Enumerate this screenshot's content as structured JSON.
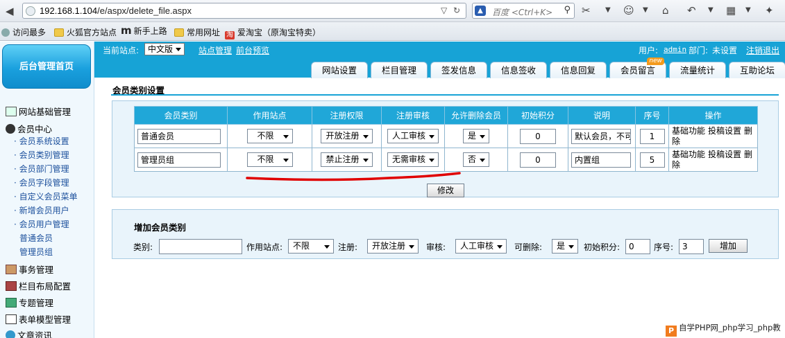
{
  "browser": {
    "url_host": "192.168.1.104",
    "url_path": "/e/aspx/delete_file.aspx",
    "search_placeholder": "百度 <Ctrl+K>",
    "bookmarks": [
      "访问最多",
      "火狐官方站点",
      "新手上路",
      "常用网址",
      "爱淘宝（原淘宝特卖）"
    ],
    "bookmark_m_logo": "m",
    "taobao_glyph": "淘"
  },
  "sidebar": {
    "home_label": "后台管理首页",
    "items": [
      {
        "label": "网站基础管理"
      },
      {
        "label": "会员中心"
      }
    ],
    "member_subitems": [
      "会员系统设置",
      "会员类别管理",
      "会员部门管理",
      "会员字段管理",
      "自定义会员菜单",
      "新增会员用户",
      "会员用户管理"
    ],
    "member_groups": [
      "普通会员",
      "管理员组"
    ],
    "more_items": [
      "事务管理",
      "栏目布局配置",
      "专题管理",
      "表单模型管理",
      "文章资讯"
    ]
  },
  "topbar": {
    "current_site_label": "当前站点:",
    "current_site_value": "中文版",
    "site_manage": "站点管理",
    "preview": "前台预览",
    "user_label": "用户:",
    "user_name": "admin",
    "dept_label": "部门:",
    "dept_value": "未设置",
    "logout": "注销退出"
  },
  "tabs": [
    "网站设置",
    "栏目管理",
    "签发信息",
    "信息签收",
    "信息回复",
    "会员留言",
    "流量统计",
    "互助论坛"
  ],
  "tab_new_badge": "new",
  "main": {
    "title": "会员类别设置",
    "table": {
      "headers": [
        "会员类别",
        "作用站点",
        "注册权限",
        "注册审核",
        "允许删除会员",
        "初始积分",
        "说明",
        "序号",
        "操作"
      ],
      "rows": [
        {
          "name": "普通会员",
          "site": "不限",
          "reg": "开放注册",
          "audit": "人工审核",
          "del": "是",
          "points": "0",
          "desc": "默认会员，不可",
          "order": "1",
          "op1": "基础功能",
          "op2": "投稿设置",
          "op3": "删除"
        },
        {
          "name": "管理员组",
          "site": "不限",
          "reg": "禁止注册",
          "audit": "无需审核",
          "del": "否",
          "points": "0",
          "desc": "内置组",
          "order": "5",
          "op1": "基础功能",
          "op2": "投稿设置",
          "op3": "删除"
        }
      ]
    },
    "modify_button": "修改"
  },
  "add": {
    "title": "增加会员类别",
    "type_label": "类别:",
    "type_value": "",
    "site_label": "作用站点:",
    "site_value": "不限",
    "reg_label": "注册:",
    "reg_value": "开放注册",
    "audit_label": "审核:",
    "audit_value": "人工审核",
    "del_label": "可删除:",
    "del_value": "是",
    "points_label": "初始积分:",
    "points_value": "0",
    "order_label": "序号:",
    "order_value": "3",
    "add_button": "增加"
  },
  "watermark": {
    "logo": "P",
    "text": "自学PHP网_php学习_php教"
  },
  "colors": {
    "accent": "#17a3d6",
    "header_cell": "#20a7d8",
    "annotation": "#e00000",
    "panel": "#e9f4fb"
  }
}
